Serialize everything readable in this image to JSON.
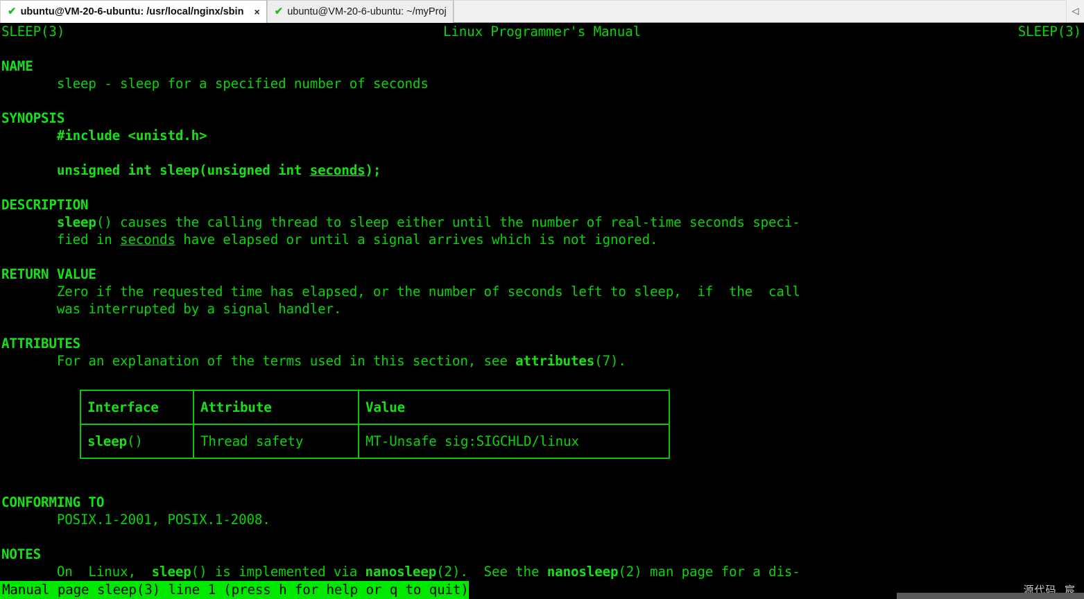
{
  "window": {
    "tabs": [
      {
        "label": "ubuntu@VM-20-6-ubuntu: /usr/local/nginx/sbin",
        "icon": "check-icon",
        "active": true,
        "close_label": "×"
      },
      {
        "label": "ubuntu@VM-20-6-ubuntu: ~/myProj",
        "icon": "check-icon",
        "active": false,
        "close_label": ""
      }
    ],
    "scroll_left_icon": "◁"
  },
  "colors": {
    "terminal_bg": "#000000",
    "terminal_fg": "#0bd30b",
    "terminal_bold_fg": "#16e016",
    "status_bg": "#00e800",
    "status_fg": "#000000",
    "tab_active_bg": "#ffffff",
    "tab_inactive_bg": "#eeeeee",
    "check_icon": "#22bb22"
  },
  "man": {
    "header": {
      "left": "SLEEP(3)",
      "center": "Linux Programmer's Manual",
      "right": "SLEEP(3)"
    },
    "sections": {
      "name": {
        "title": "NAME",
        "body": "sleep - sleep for a specified number of seconds"
      },
      "synopsis": {
        "title": "SYNOPSIS",
        "include": "#include <unistd.h>",
        "proto_a": "unsigned int sleep(unsigned int ",
        "proto_arg": "seconds",
        "proto_b": ");"
      },
      "description": {
        "title": "DESCRIPTION",
        "l1_fn": "sleep",
        "l1_rest": "() causes the calling thread to sleep either until the number of real-time seconds speci-",
        "l2_a": "fied in ",
        "l2_arg": "seconds",
        "l2_b": " have elapsed or until a signal arrives which is not ignored."
      },
      "return_value": {
        "title": "RETURN VALUE",
        "l1": "Zero if the requested time has elapsed, or the number of seconds left to sleep,  if  the  call",
        "l2": "was interrupted by a signal handler."
      },
      "attributes": {
        "title": "ATTRIBUTES",
        "l1_a": "For an explanation of the terms used in this section, see ",
        "l1_ref": "attributes",
        "l1_b": "(7).",
        "table": {
          "headers": [
            "Interface",
            "Attribute",
            "Value"
          ],
          "rows": [
            {
              "interface_bold": "sleep",
              "interface_rest": "()",
              "attribute": "Thread safety",
              "value": "MT-Unsafe sig:SIGCHLD/linux"
            }
          ]
        }
      },
      "conforming_to": {
        "title": "CONFORMING TO",
        "body": "POSIX.1-2001, POSIX.1-2008."
      },
      "notes": {
        "title": "NOTES",
        "l1_a": "On  Linux,  ",
        "l1_fn1": "sleep",
        "l1_b": "() is implemented via ",
        "l1_fn2": "nanosleep",
        "l1_c": "(2).  See the ",
        "l1_fn3": "nanosleep",
        "l1_d": "(2) man page for a dis-"
      }
    },
    "status_line": "Manual page sleep(3) line 1 (press h for help or q to quit)"
  },
  "watermark": "源代码  宸"
}
